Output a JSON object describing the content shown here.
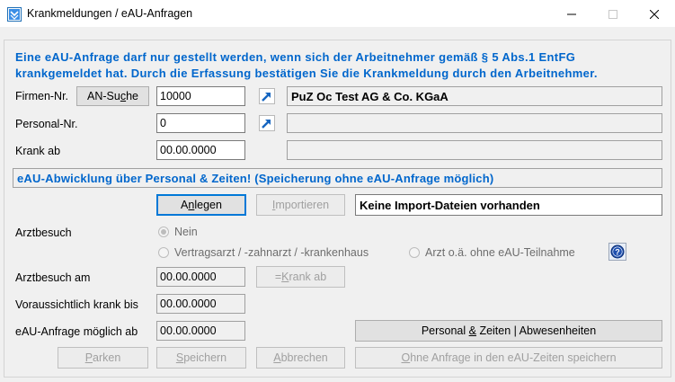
{
  "window": {
    "title": "Krankmeldungen / eAU-Anfragen"
  },
  "notice": "Eine eAU-Anfrage darf nur gestellt werden, wenn sich der Arbeitnehmer gemäß § 5 Abs.1 EntFG krankgemeldet hat. Durch die Erfassung bestätigen Sie die Krankmeldung durch den Arbeitnehmer.",
  "firm": {
    "label": "Firmen-Nr.",
    "search_button": {
      "pre": "AN-Su",
      "u": "c",
      "post": "he"
    },
    "value": "10000",
    "name": "PuZ Oc Test AG & Co. KGaA"
  },
  "personal": {
    "label": "Personal-Nr.",
    "value": "0",
    "name": ""
  },
  "krank_ab": {
    "label": "Krank ab",
    "value": "00.00.0000",
    "extra": ""
  },
  "banner": "eAU-Abwicklung über Personal & Zeiten! (Speicherung ohne eAU-Anfrage möglich)",
  "actions": {
    "anlegen": {
      "pre": "A",
      "u": "n",
      "post": "legen"
    },
    "importieren": {
      "pre": "",
      "u": "I",
      "post": "mportieren"
    },
    "import_status": "Keine Import-Dateien vorhanden"
  },
  "arztbesuch": {
    "label": "Arztbesuch",
    "options": {
      "nein": "Nein",
      "vertragsarzt": "Vertragsarzt / -zahnarzt / -krankenhaus",
      "arzt_oa": "Arzt o.ä. ohne eAU-Teilnahme"
    },
    "selected": "nein"
  },
  "arztbesuch_am": {
    "label": "Arztbesuch am",
    "value": "00.00.0000",
    "button": {
      "pre": "= ",
      "u": "K",
      "post": "rank ab"
    }
  },
  "voraussichtlich": {
    "label": "Voraussichtlich krank bis",
    "value": "00.00.0000"
  },
  "eau_moeglich": {
    "label": "eAU-Anfrage möglich ab",
    "value": "00.00.0000",
    "button": {
      "pre": "Personal ",
      "u": "&",
      "post": " Zeiten | Abwesenheiten"
    }
  },
  "footer": {
    "parken": {
      "pre": "",
      "u": "P",
      "post": "arken"
    },
    "speichern": {
      "pre": "",
      "u": "S",
      "post": "peichern"
    },
    "abbrechen": {
      "pre": "",
      "u": "A",
      "post": "bbrechen"
    },
    "ohne_anfrage": {
      "pre": "",
      "u": "O",
      "post": "hne Anfrage in den eAU-Zeiten speichern"
    }
  },
  "colors": {
    "accent_blue": "#0066cc",
    "dialog_bg": "#f0f0f0",
    "disabled_text": "#a0a0a0"
  },
  "icons": [
    "app-icon",
    "minimize-icon",
    "maximize-icon",
    "close-icon",
    "jump-arrow-icon",
    "help-icon"
  ]
}
